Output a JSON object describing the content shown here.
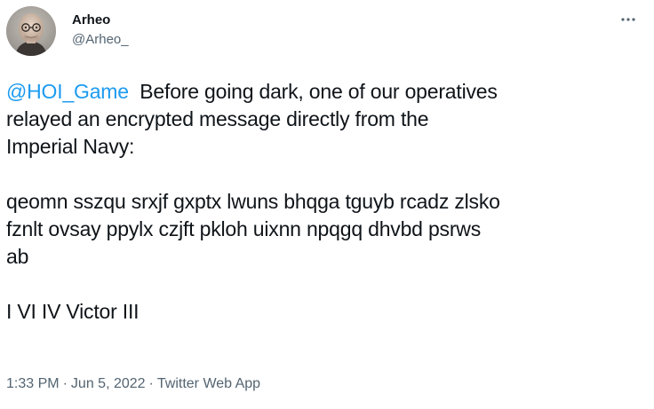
{
  "author": {
    "display_name": "Arheo",
    "handle": "@Arheo_"
  },
  "tweet": {
    "mention": "@HOI_Game",
    "line1_rest": "Before going dark, one of our operatives",
    "line2": "relayed an encrypted message directly from the",
    "line3": "Imperial Navy:",
    "cipher_line1": "qeomn sszqu srxjf gxptx lwuns bhqga tguyb rcadz zlsko",
    "cipher_line2": "fznlt ovsay ppylx czjft pkloh uixnn npqgq dhvbd psrws",
    "cipher_line3": "ab",
    "signoff": "I VI IV Victor III"
  },
  "meta": {
    "time": "1:33 PM",
    "date": "Jun 5, 2022",
    "source": "Twitter Web App",
    "separator": "·"
  },
  "colors": {
    "link": "#1d9bf0",
    "text": "#0f1419",
    "secondary": "#536471"
  },
  "icons": {
    "more": "more-horizontal-icon"
  }
}
